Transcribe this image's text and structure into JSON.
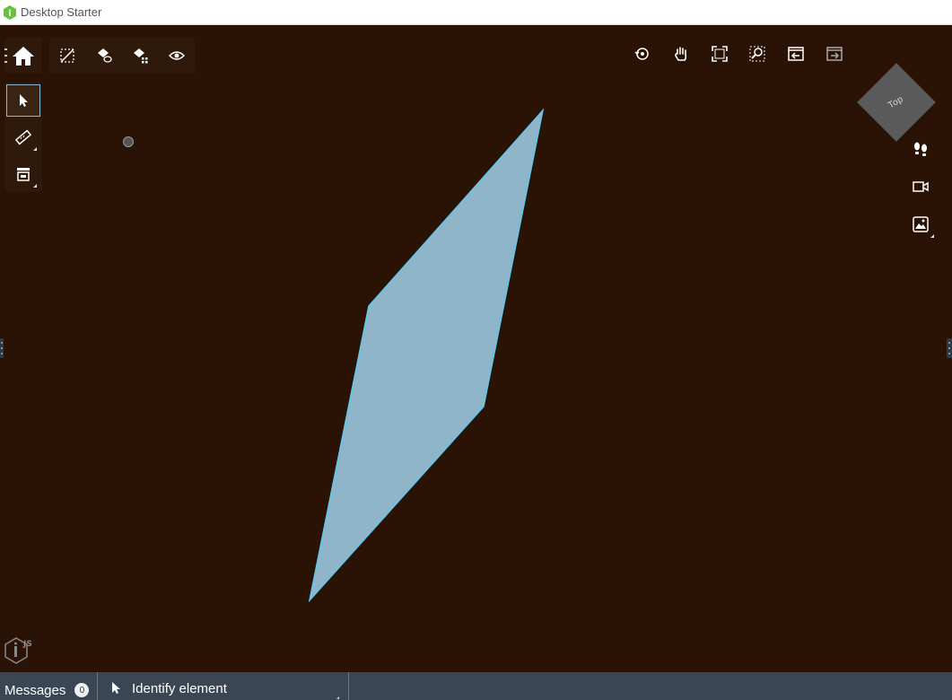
{
  "window": {
    "title": "Desktop Starter"
  },
  "toolbar": {
    "home_icon": "home-icon",
    "view_tools": [
      "clip-icon",
      "isolate-icon",
      "hide-icon",
      "visibility-icon"
    ],
    "side_tools": [
      "select-icon",
      "measure-icon",
      "section-icon"
    ]
  },
  "navigation": {
    "icons": [
      "rotate-icon",
      "pan-icon",
      "fit-view-icon",
      "window-zoom-icon",
      "view-back-icon",
      "view-forward-icon"
    ]
  },
  "view_cube": {
    "label": "Top"
  },
  "right_tools": [
    "walk-icon",
    "camera-icon",
    "render-style-icon"
  ],
  "statusbar": {
    "messages_label": "Messages",
    "messages_count": "0",
    "tool_label": "Identify element"
  },
  "colors": {
    "background": "#2a1204",
    "shape_fill": "#90b4c8",
    "shape_stroke": "#5ec8f0",
    "statusbar": "#3b4654"
  }
}
